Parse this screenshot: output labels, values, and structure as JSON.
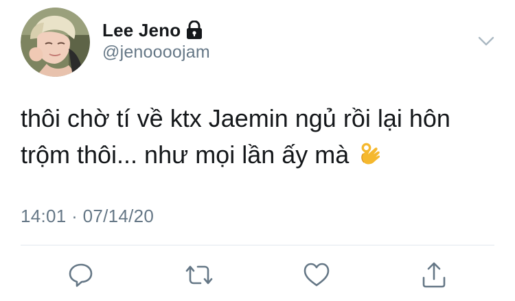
{
  "user": {
    "display_name": "Lee Jeno",
    "handle": "@jenoooojam",
    "protected_icon": "lock-icon",
    "avatar_icon": "avatar-photo"
  },
  "tweet": {
    "line1": "thôi chờ tí về ktx Jaemin ngủ rồi lại hôn",
    "line2": "trộm thôi... như mọi lần ấy mà",
    "emoji": "ok-hand-emoji",
    "timestamp": "14:01 · 07/14/20"
  },
  "actions": {
    "reply_icon": "reply-icon",
    "retweet_icon": "retweet-icon",
    "like_icon": "heart-icon",
    "share_icon": "share-icon",
    "more_icon": "chevron-down-icon"
  },
  "colors": {
    "text": "#14171a",
    "secondary": "#657786",
    "divider": "#e1e8ed",
    "emoji": "#f5b82e"
  }
}
